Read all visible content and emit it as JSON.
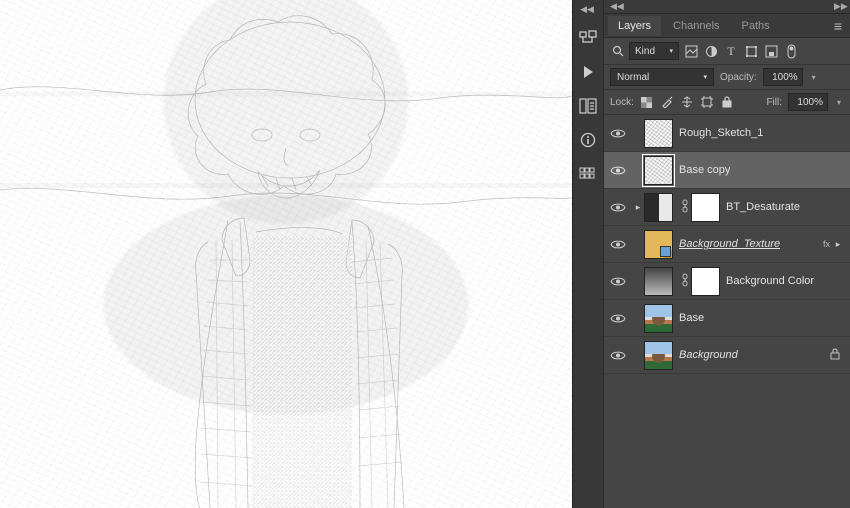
{
  "tabs": {
    "layers": "Layers",
    "channels": "Channels",
    "paths": "Paths"
  },
  "filter": {
    "kind": "Kind"
  },
  "blend": {
    "mode": "Normal",
    "opacity_label": "Opacity:",
    "opacity_value": "100%"
  },
  "lock": {
    "label": "Lock:",
    "fill_label": "Fill:",
    "fill_value": "100%"
  },
  "fx_label": "fx",
  "layers": [
    {
      "name": "Rough_Sketch_1"
    },
    {
      "name": "Base copy"
    },
    {
      "name": "BT_Desaturate"
    },
    {
      "name": "Background_Texture "
    },
    {
      "name": "Background Color"
    },
    {
      "name": "Base"
    },
    {
      "name": "Background"
    }
  ]
}
